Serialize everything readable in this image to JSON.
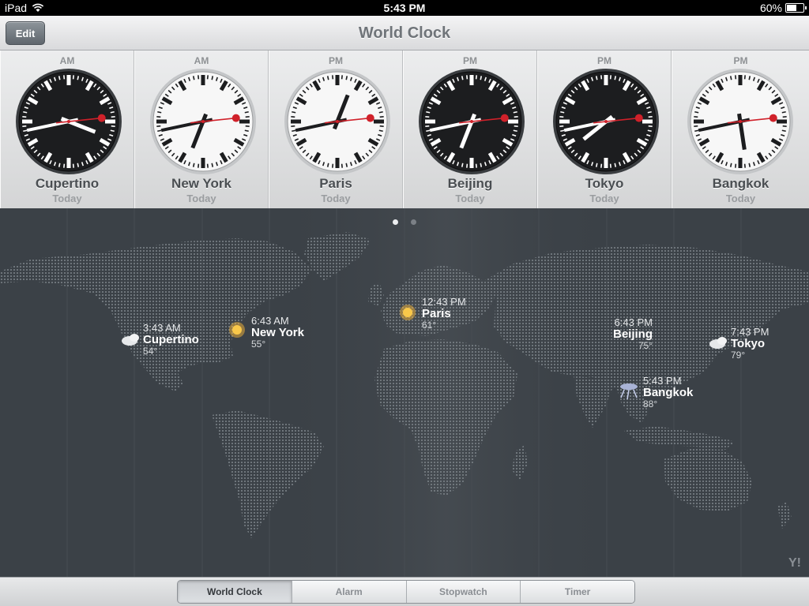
{
  "status_bar": {
    "device": "iPad",
    "time": "5:43 PM",
    "battery": "60%",
    "battery_level": 0.6
  },
  "nav": {
    "title": "World Clock",
    "edit_label": "Edit"
  },
  "clocks": [
    {
      "ampm": "AM",
      "city": "Cupertino",
      "day": "Today",
      "theme": "dark",
      "hour": 3,
      "minute": 43,
      "second": 14
    },
    {
      "ampm": "AM",
      "city": "New York",
      "day": "Today",
      "theme": "light",
      "hour": 6,
      "minute": 43,
      "second": 14
    },
    {
      "ampm": "PM",
      "city": "Paris",
      "day": "Today",
      "theme": "light",
      "hour": 12,
      "minute": 43,
      "second": 14
    },
    {
      "ampm": "PM",
      "city": "Beijing",
      "day": "Today",
      "theme": "dark",
      "hour": 6,
      "minute": 43,
      "second": 14
    },
    {
      "ampm": "PM",
      "city": "Tokyo",
      "day": "Today",
      "theme": "dark",
      "hour": 7,
      "minute": 43,
      "second": 14
    },
    {
      "ampm": "PM",
      "city": "Bangkok",
      "day": "Today",
      "theme": "light",
      "hour": 5,
      "minute": 43,
      "second": 14
    }
  ],
  "page_indicator": {
    "pages": 2,
    "current": 0
  },
  "map_markers": [
    {
      "time": "3:43 AM",
      "city": "Cupertino",
      "temp": "54°",
      "weather": "cloud-icon"
    },
    {
      "time": "6:43 AM",
      "city": "New York",
      "temp": "55°",
      "weather": "sun-icon"
    },
    {
      "time": "12:43 PM",
      "city": "Paris",
      "temp": "61°",
      "weather": "sun-icon"
    },
    {
      "time": "6:43 PM",
      "city": "Beijing",
      "temp": "75°",
      "weather": "none"
    },
    {
      "time": "7:43 PM",
      "city": "Tokyo",
      "temp": "79°",
      "weather": "cloud-icon"
    },
    {
      "time": "5:43 PM",
      "city": "Bangkok",
      "temp": "88°",
      "weather": "thunderstorm-icon"
    }
  ],
  "tabs": [
    {
      "label": "World Clock",
      "active": true
    },
    {
      "label": "Alarm",
      "active": false
    },
    {
      "label": "Stopwatch",
      "active": false
    },
    {
      "label": "Timer",
      "active": false
    }
  ],
  "colors": {
    "map_background": "#3b4147",
    "second_hand": "#d0212a"
  }
}
